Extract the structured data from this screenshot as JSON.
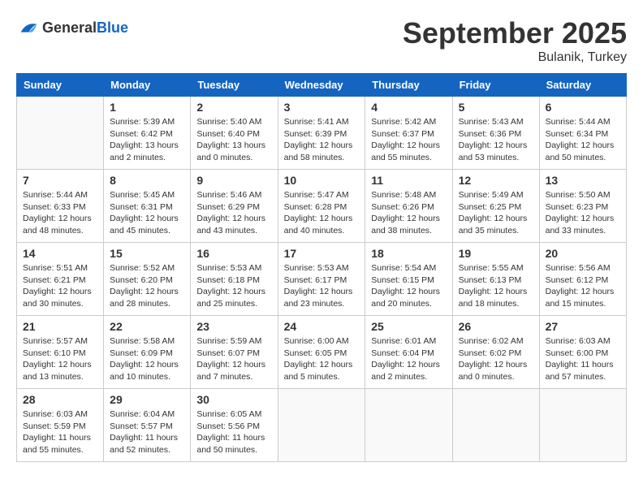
{
  "logo": {
    "general": "General",
    "blue": "Blue"
  },
  "title": "September 2025",
  "location": "Bulanik, Turkey",
  "days_of_week": [
    "Sunday",
    "Monday",
    "Tuesday",
    "Wednesday",
    "Thursday",
    "Friday",
    "Saturday"
  ],
  "weeks": [
    [
      {
        "day": "",
        "info": ""
      },
      {
        "day": "1",
        "info": "Sunrise: 5:39 AM\nSunset: 6:42 PM\nDaylight: 13 hours\nand 2 minutes."
      },
      {
        "day": "2",
        "info": "Sunrise: 5:40 AM\nSunset: 6:40 PM\nDaylight: 13 hours\nand 0 minutes."
      },
      {
        "day": "3",
        "info": "Sunrise: 5:41 AM\nSunset: 6:39 PM\nDaylight: 12 hours\nand 58 minutes."
      },
      {
        "day": "4",
        "info": "Sunrise: 5:42 AM\nSunset: 6:37 PM\nDaylight: 12 hours\nand 55 minutes."
      },
      {
        "day": "5",
        "info": "Sunrise: 5:43 AM\nSunset: 6:36 PM\nDaylight: 12 hours\nand 53 minutes."
      },
      {
        "day": "6",
        "info": "Sunrise: 5:44 AM\nSunset: 6:34 PM\nDaylight: 12 hours\nand 50 minutes."
      }
    ],
    [
      {
        "day": "7",
        "info": "Sunrise: 5:44 AM\nSunset: 6:33 PM\nDaylight: 12 hours\nand 48 minutes."
      },
      {
        "day": "8",
        "info": "Sunrise: 5:45 AM\nSunset: 6:31 PM\nDaylight: 12 hours\nand 45 minutes."
      },
      {
        "day": "9",
        "info": "Sunrise: 5:46 AM\nSunset: 6:29 PM\nDaylight: 12 hours\nand 43 minutes."
      },
      {
        "day": "10",
        "info": "Sunrise: 5:47 AM\nSunset: 6:28 PM\nDaylight: 12 hours\nand 40 minutes."
      },
      {
        "day": "11",
        "info": "Sunrise: 5:48 AM\nSunset: 6:26 PM\nDaylight: 12 hours\nand 38 minutes."
      },
      {
        "day": "12",
        "info": "Sunrise: 5:49 AM\nSunset: 6:25 PM\nDaylight: 12 hours\nand 35 minutes."
      },
      {
        "day": "13",
        "info": "Sunrise: 5:50 AM\nSunset: 6:23 PM\nDaylight: 12 hours\nand 33 minutes."
      }
    ],
    [
      {
        "day": "14",
        "info": "Sunrise: 5:51 AM\nSunset: 6:21 PM\nDaylight: 12 hours\nand 30 minutes."
      },
      {
        "day": "15",
        "info": "Sunrise: 5:52 AM\nSunset: 6:20 PM\nDaylight: 12 hours\nand 28 minutes."
      },
      {
        "day": "16",
        "info": "Sunrise: 5:53 AM\nSunset: 6:18 PM\nDaylight: 12 hours\nand 25 minutes."
      },
      {
        "day": "17",
        "info": "Sunrise: 5:53 AM\nSunset: 6:17 PM\nDaylight: 12 hours\nand 23 minutes."
      },
      {
        "day": "18",
        "info": "Sunrise: 5:54 AM\nSunset: 6:15 PM\nDaylight: 12 hours\nand 20 minutes."
      },
      {
        "day": "19",
        "info": "Sunrise: 5:55 AM\nSunset: 6:13 PM\nDaylight: 12 hours\nand 18 minutes."
      },
      {
        "day": "20",
        "info": "Sunrise: 5:56 AM\nSunset: 6:12 PM\nDaylight: 12 hours\nand 15 minutes."
      }
    ],
    [
      {
        "day": "21",
        "info": "Sunrise: 5:57 AM\nSunset: 6:10 PM\nDaylight: 12 hours\nand 13 minutes."
      },
      {
        "day": "22",
        "info": "Sunrise: 5:58 AM\nSunset: 6:09 PM\nDaylight: 12 hours\nand 10 minutes."
      },
      {
        "day": "23",
        "info": "Sunrise: 5:59 AM\nSunset: 6:07 PM\nDaylight: 12 hours\nand 7 minutes."
      },
      {
        "day": "24",
        "info": "Sunrise: 6:00 AM\nSunset: 6:05 PM\nDaylight: 12 hours\nand 5 minutes."
      },
      {
        "day": "25",
        "info": "Sunrise: 6:01 AM\nSunset: 6:04 PM\nDaylight: 12 hours\nand 2 minutes."
      },
      {
        "day": "26",
        "info": "Sunrise: 6:02 AM\nSunset: 6:02 PM\nDaylight: 12 hours\nand 0 minutes."
      },
      {
        "day": "27",
        "info": "Sunrise: 6:03 AM\nSunset: 6:00 PM\nDaylight: 11 hours\nand 57 minutes."
      }
    ],
    [
      {
        "day": "28",
        "info": "Sunrise: 6:03 AM\nSunset: 5:59 PM\nDaylight: 11 hours\nand 55 minutes."
      },
      {
        "day": "29",
        "info": "Sunrise: 6:04 AM\nSunset: 5:57 PM\nDaylight: 11 hours\nand 52 minutes."
      },
      {
        "day": "30",
        "info": "Sunrise: 6:05 AM\nSunset: 5:56 PM\nDaylight: 11 hours\nand 50 minutes."
      },
      {
        "day": "",
        "info": ""
      },
      {
        "day": "",
        "info": ""
      },
      {
        "day": "",
        "info": ""
      },
      {
        "day": "",
        "info": ""
      }
    ]
  ]
}
